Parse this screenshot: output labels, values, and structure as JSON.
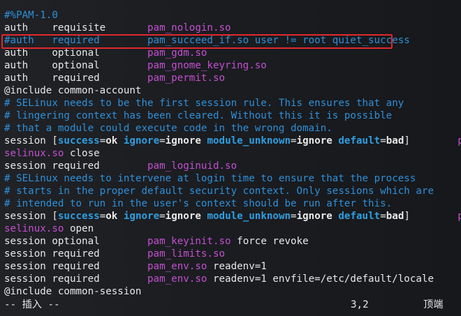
{
  "editor": {
    "lines": [
      [
        {
          "t": "#%PAM-1.0",
          "c": "cmt"
        }
      ],
      [
        {
          "t": "auth    ",
          "c": "kw"
        },
        {
          "t": "requisite       ",
          "c": "kw"
        },
        {
          "t": "pam_nologin.so",
          "c": "mod"
        }
      ],
      [
        {
          "t": "#auth   required        pam_succeed_if.so user != root quiet_success",
          "c": "cmt"
        }
      ],
      [
        {
          "t": "auth    ",
          "c": "kw"
        },
        {
          "t": "optional        ",
          "c": "kw"
        },
        {
          "t": "pam_gdm.so",
          "c": "mod"
        }
      ],
      [
        {
          "t": "auth    ",
          "c": "kw"
        },
        {
          "t": "optional        ",
          "c": "kw"
        },
        {
          "t": "pam_gnome_keyring.so",
          "c": "mod"
        }
      ],
      [
        {
          "t": "auth    ",
          "c": "kw"
        },
        {
          "t": "required        ",
          "c": "kw"
        },
        {
          "t": "pam_permit.so",
          "c": "mod"
        }
      ],
      [
        {
          "t": "@include common-account",
          "c": "inc"
        }
      ],
      [
        {
          "t": "# SELinux needs to be the first session rule. This ensures that any",
          "c": "cmt"
        }
      ],
      [
        {
          "t": "# lingering context has been cleared. Without this it is possible",
          "c": "cmt"
        }
      ],
      [
        {
          "t": "# that a module could execute code in the wrong domain.",
          "c": "cmt"
        }
      ],
      [
        {
          "t": "session ",
          "c": "kw"
        },
        {
          "t": "[",
          "c": "br"
        },
        {
          "t": "success",
          "c": "bkey"
        },
        {
          "t": "=",
          "c": "eq"
        },
        {
          "t": "ok ",
          "c": "bval"
        },
        {
          "t": "ignore",
          "c": "bkey"
        },
        {
          "t": "=",
          "c": "eq"
        },
        {
          "t": "ignore ",
          "c": "bval"
        },
        {
          "t": "module_unknown",
          "c": "bkey"
        },
        {
          "t": "=",
          "c": "eq"
        },
        {
          "t": "ignore ",
          "c": "bval"
        },
        {
          "t": "default",
          "c": "bkey"
        },
        {
          "t": "=",
          "c": "eq"
        },
        {
          "t": "bad",
          "c": "bval"
        },
        {
          "t": "]        ",
          "c": "br"
        },
        {
          "t": "pam_",
          "c": "mod"
        }
      ],
      [
        {
          "t": "selinux.so",
          "c": "mod"
        },
        {
          "t": " close",
          "c": "arg"
        }
      ],
      [
        {
          "t": "session ",
          "c": "kw"
        },
        {
          "t": "required        ",
          "c": "kw"
        },
        {
          "t": "pam_loginuid.so",
          "c": "mod"
        }
      ],
      [
        {
          "t": "# SELinux needs to intervene at login time to ensure that the process",
          "c": "cmt"
        }
      ],
      [
        {
          "t": "# starts in the proper default security context. Only sessions which are",
          "c": "cmt"
        }
      ],
      [
        {
          "t": "# intended to run in the user's context should be run after this.",
          "c": "cmt"
        }
      ],
      [
        {
          "t": "session ",
          "c": "kw"
        },
        {
          "t": "[",
          "c": "br"
        },
        {
          "t": "success",
          "c": "bkey"
        },
        {
          "t": "=",
          "c": "eq"
        },
        {
          "t": "ok ",
          "c": "bval"
        },
        {
          "t": "ignore",
          "c": "bkey"
        },
        {
          "t": "=",
          "c": "eq"
        },
        {
          "t": "ignore ",
          "c": "bval"
        },
        {
          "t": "module_unknown",
          "c": "bkey"
        },
        {
          "t": "=",
          "c": "eq"
        },
        {
          "t": "ignore ",
          "c": "bval"
        },
        {
          "t": "default",
          "c": "bkey"
        },
        {
          "t": "=",
          "c": "eq"
        },
        {
          "t": "bad",
          "c": "bval"
        },
        {
          "t": "]        ",
          "c": "br"
        },
        {
          "t": "pam_",
          "c": "mod"
        }
      ],
      [
        {
          "t": "selinux.so",
          "c": "mod"
        },
        {
          "t": " open",
          "c": "arg"
        }
      ],
      [
        {
          "t": "session ",
          "c": "kw"
        },
        {
          "t": "optional        ",
          "c": "kw"
        },
        {
          "t": "pam_keyinit.so",
          "c": "mod"
        },
        {
          "t": " force revoke",
          "c": "arg"
        }
      ],
      [
        {
          "t": "session ",
          "c": "kw"
        },
        {
          "t": "required        ",
          "c": "kw"
        },
        {
          "t": "pam_limits.so",
          "c": "mod"
        }
      ],
      [
        {
          "t": "session ",
          "c": "kw"
        },
        {
          "t": "required        ",
          "c": "kw"
        },
        {
          "t": "pam_env.so",
          "c": "mod"
        },
        {
          "t": " readenv=1",
          "c": "arg"
        }
      ],
      [
        {
          "t": "session ",
          "c": "kw"
        },
        {
          "t": "required        ",
          "c": "kw"
        },
        {
          "t": "pam_env.so",
          "c": "mod"
        },
        {
          "t": " readenv=1 envfile=/etc/default/locale",
          "c": "arg"
        }
      ],
      [
        {
          "t": "@include common-session",
          "c": "inc"
        }
      ]
    ],
    "highlighted_line": 2
  },
  "status_bar": {
    "mode": "-- 插入 --",
    "cursor_position": "3,2",
    "scroll_position": "顶端"
  },
  "colors": {
    "comment": "#2f8fd8",
    "module": "#c44fd0",
    "highlight_border": "#e0282e"
  }
}
